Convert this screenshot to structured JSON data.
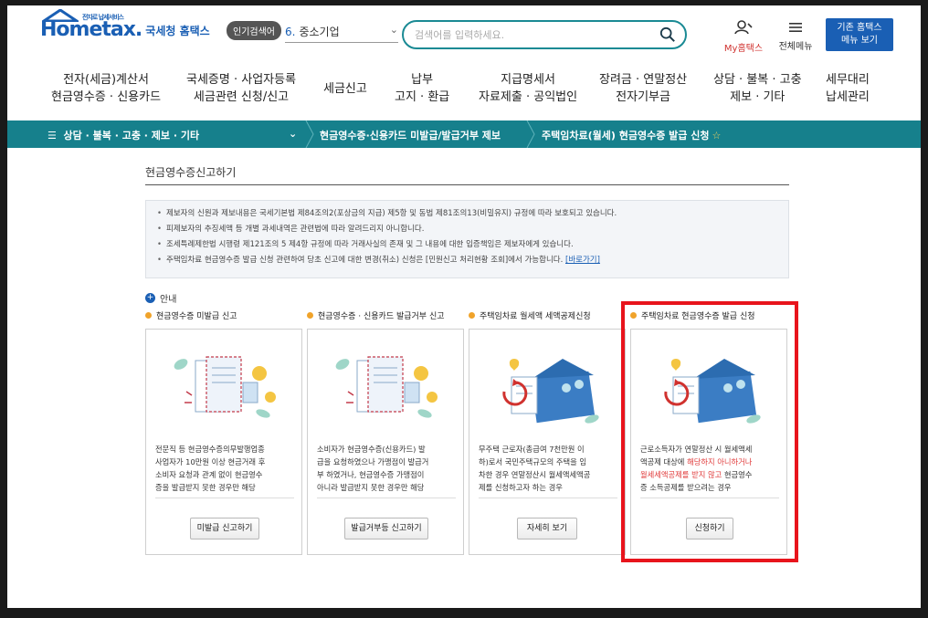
{
  "header": {
    "logo_word": "Hometax.",
    "logo_sub": "국세청 홈택스",
    "logo_small": "전자로 납세서비스",
    "popular_badge": "인기검색어",
    "popular_rank": "6.",
    "popular_term": "중소기업",
    "search_placeholder": "검색어를 입력하세요.",
    "mytax": "My홈택스",
    "allmenu": "전체메뉴",
    "old_home_line1": "기존 홈택스",
    "old_home_line2": "메뉴 보기"
  },
  "nav": [
    {
      "l1": "전자(세금)계산서",
      "l2": "현금영수증 · 신용카드"
    },
    {
      "l1": "국세증명 · 사업자등록",
      "l2": "세금관련 신청/신고"
    },
    {
      "l1": "세금신고",
      "l2": ""
    },
    {
      "l1": "납부",
      "l2": "고지 · 환급"
    },
    {
      "l1": "지급명세서",
      "l2": "자료제출 · 공익법인"
    },
    {
      "l1": "장려금 · 연말정산",
      "l2": "전자기부금"
    },
    {
      "l1": "상담 · 불복 · 고충",
      "l2": "제보 · 기타"
    },
    {
      "l1": "세무대리",
      "l2": "납세관리"
    }
  ],
  "breadcrumb": {
    "menu": "상담 · 불복 · 고충 · 제보 · 기타",
    "item2": "현금영수증·신용카드 미발급/발급거부 제보",
    "item3": "주택임차료(월세) 현금영수증 발급 신청",
    "star": "☆"
  },
  "page_title": "현금영수증신고하기",
  "notices": [
    "제보자의 신원과 제보내용은 국세기본법 제84조의2(포상금의 지급) 제5항 및 동법 제81조의13(비밀유지) 규정에 따라 보호되고 있습니다.",
    "피제보자의 추징세액 등 개별 과세내역은 관련법에 따라 알려드리지 아니합니다.",
    "조세특례제한법 시행령 제121조의 5 제4항 규정에 따라 거래사실의 존재 및 그 내용에 대한 입증책임은 제보자에게 있습니다.",
    "주택임차료 현금영수증 발급 신청 관련하여 당초 신고에 대한 변경(취소) 신청은 [민원신고 처리현황 조회]에서 가능합니다."
  ],
  "notice_link": "[바로가기]",
  "guide_label": "안내",
  "guide_icon": "+",
  "cards": [
    {
      "title": "현금영수증 미발급 신고",
      "desc": [
        "전문직 등 현금영수증의무발행업종",
        "사업자가 10만원 이상 현금거래 후",
        "소비자 요청과 관계 없이 현금영수",
        "증을 발급받지 못한 경우만 해당"
      ],
      "button": "미발급 신고하기"
    },
    {
      "title": "현금영수증 · 신용카드 발급거부 신고",
      "desc": [
        "소비자가 현금영수증(신용카드) 발",
        "급을 요청하였으나 가맹점이 발급거",
        "부 하였거나, 현금영수증 가맹점이",
        "아니라 발급받지 못한 경우만 해당"
      ],
      "button": "발급거부등 신고하기"
    },
    {
      "title": "주택임차료 월세액 세액공제신청",
      "desc": [
        "무주택 근로자(총급여 7천만원 이",
        "하)로서 국민주택규모의 주택을 임",
        "차한 경우 연말정산시 월세액세액공",
        "제를 신청하고자 하는 경우"
      ],
      "button": "자세히 보기"
    },
    {
      "title": "주택임차료 현금영수증 발급 신청",
      "desc_a": "근로소득자가 연말정산 시 월세액세",
      "desc_b": "액공제 대상에 ",
      "desc_red1": "해당하지 아니하거나",
      "desc_red2": "월세세액공제를 받지 않고",
      "desc_c": " 현금영수",
      "desc_d": "증 소득공제를 받으려는 경우",
      "button": "신청하기"
    }
  ]
}
